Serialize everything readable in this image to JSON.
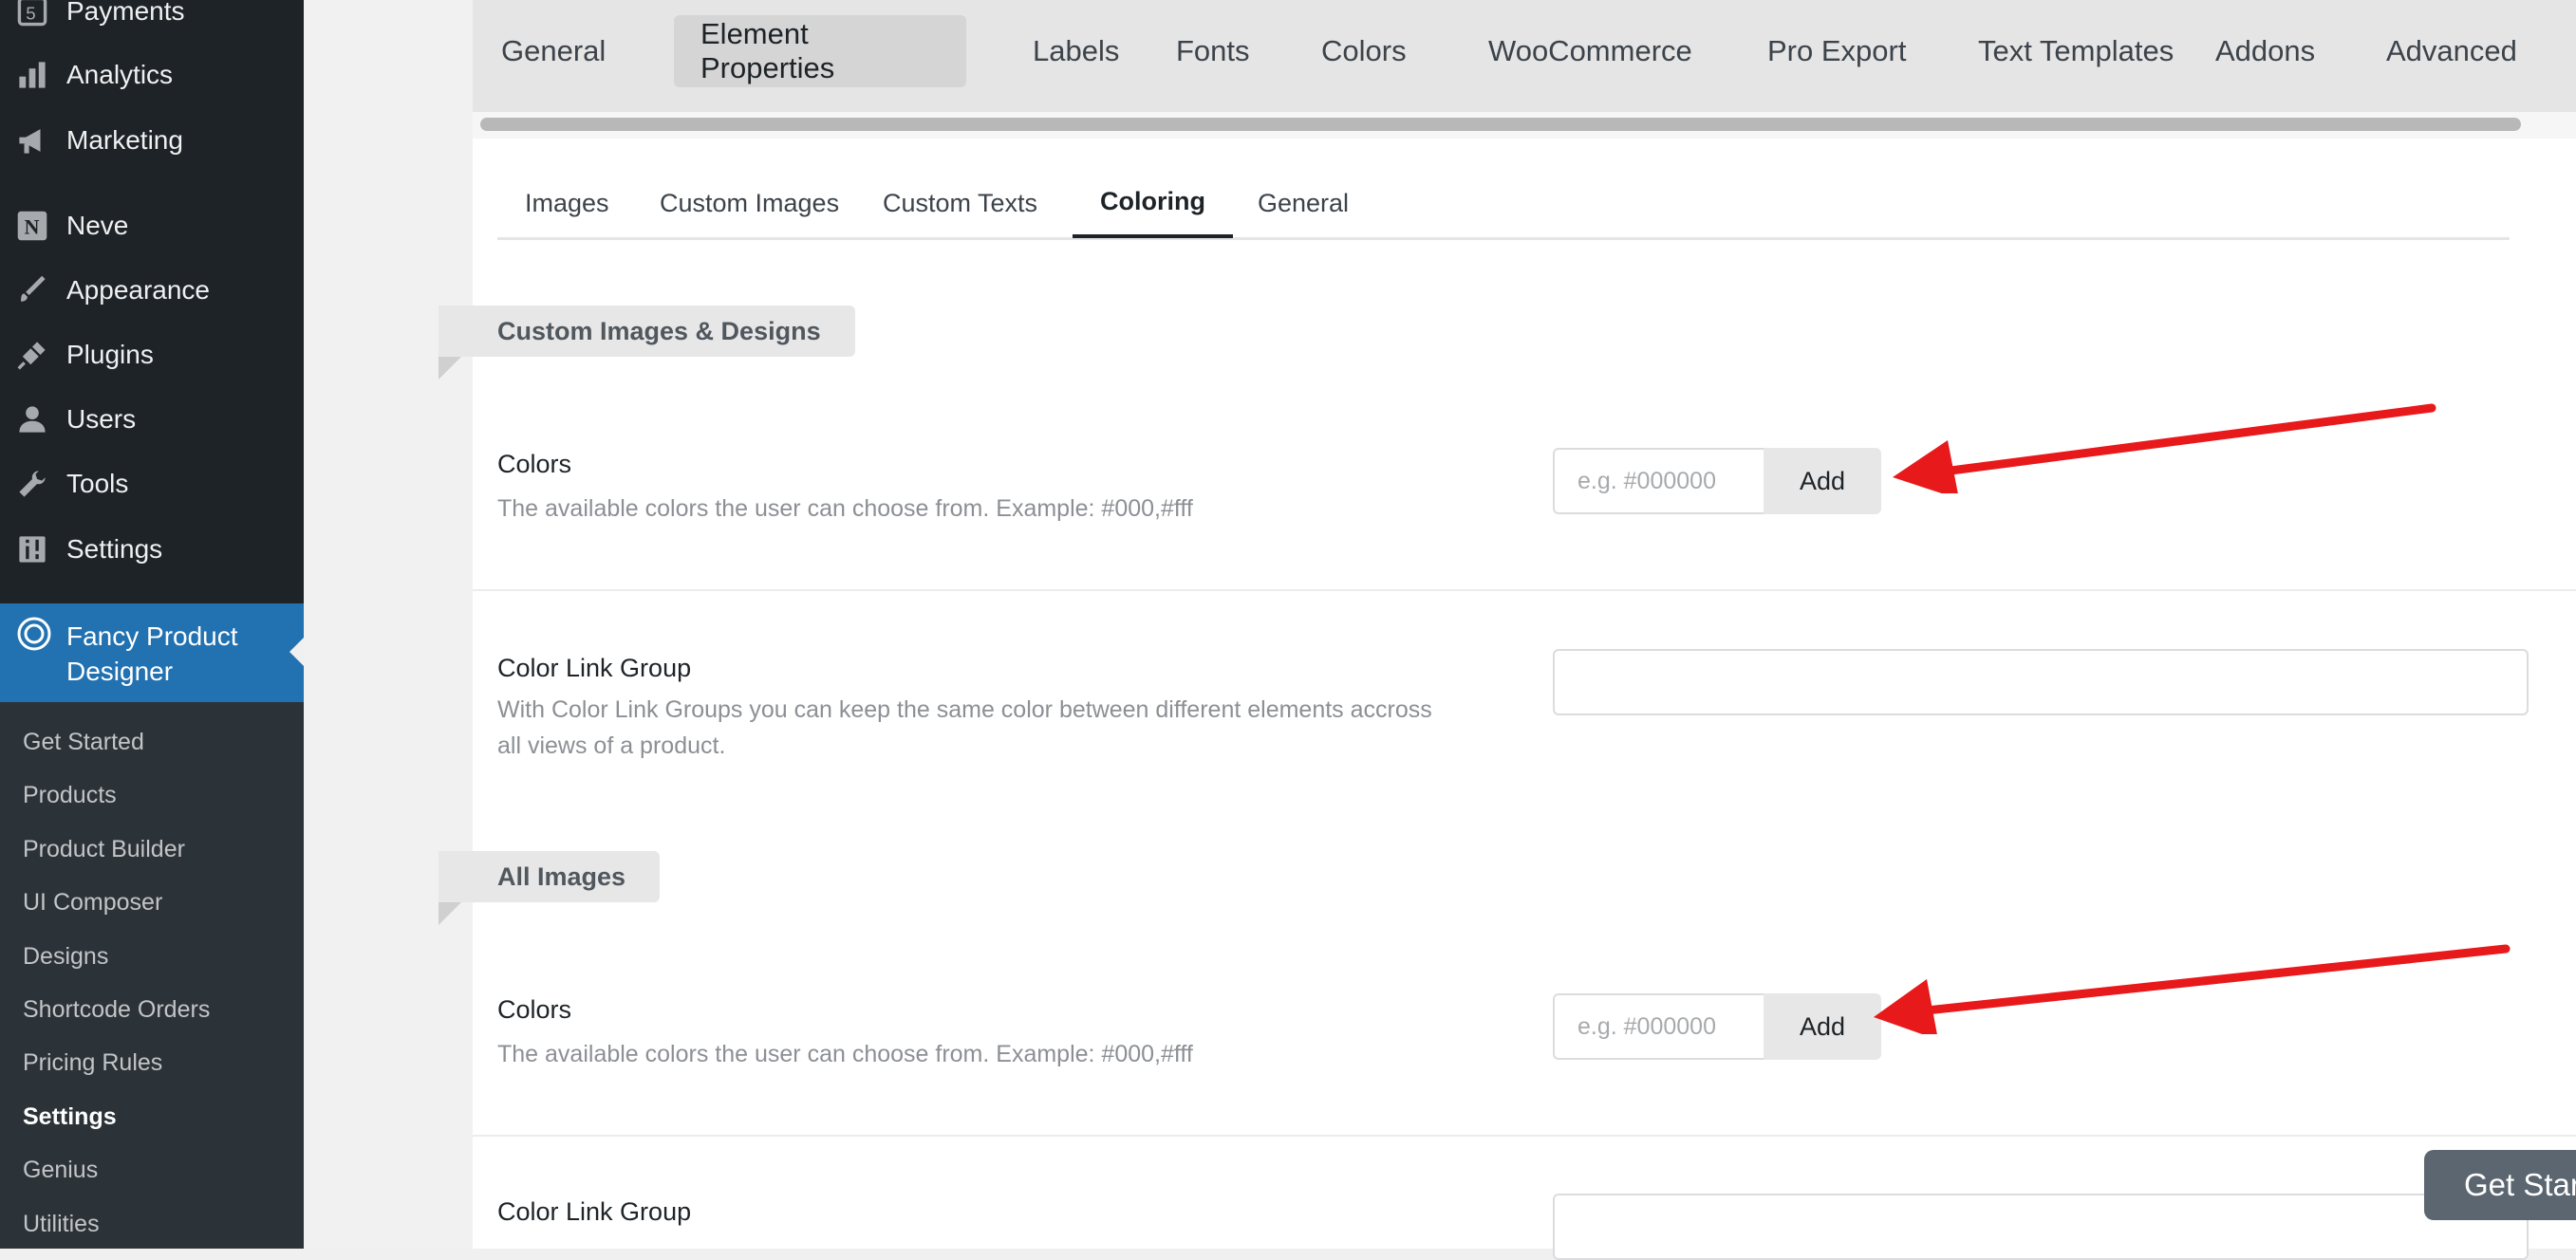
{
  "sidebar": {
    "items": [
      {
        "label": "Payments",
        "icon": "payments-icon"
      },
      {
        "label": "Analytics",
        "icon": "analytics-icon"
      },
      {
        "label": "Marketing",
        "icon": "megaphone-icon"
      },
      {
        "label": "Neve",
        "icon": "neve-icon"
      },
      {
        "label": "Appearance",
        "icon": "paintbrush-icon"
      },
      {
        "label": "Plugins",
        "icon": "plug-icon"
      },
      {
        "label": "Users",
        "icon": "user-icon"
      },
      {
        "label": "Tools",
        "icon": "wrench-icon"
      },
      {
        "label": "Settings",
        "icon": "sliders-icon"
      }
    ],
    "current": {
      "label": "Fancy Product Designer",
      "icon": "fpd-ring-icon"
    },
    "submenu": [
      "Get Started",
      "Products",
      "Product Builder",
      "UI Composer",
      "Designs",
      "Shortcode Orders",
      "Pricing Rules",
      "Settings",
      "Genius",
      "Utilities"
    ],
    "submenu_active": "Settings"
  },
  "top_tabs": [
    "General",
    "Element Properties",
    "Labels",
    "Fonts",
    "Colors",
    "WooCommerce",
    "Pro Export",
    "Text Templates",
    "Addons",
    "Advanced"
  ],
  "top_tab_active": "Element Properties",
  "sub_tabs": [
    "Images",
    "Custom Images",
    "Custom Texts",
    "Coloring",
    "General"
  ],
  "sub_tab_active": "Coloring",
  "sections": [
    {
      "title": "Custom Images & Designs",
      "colors": {
        "label": "Colors",
        "desc": "The available colors the user can choose from. Example: #000,#fff",
        "placeholder": "e.g. #000000",
        "button": "Add"
      },
      "link_group": {
        "label": "Color Link Group",
        "desc": "With Color Link Groups you can keep the same color between different elements accross all views of a product."
      }
    },
    {
      "title": "All Images",
      "colors": {
        "label": "Colors",
        "desc": "The available colors the user can choose from. Example: #000,#fff",
        "placeholder": "e.g. #000000",
        "button": "Add"
      },
      "link_group": {
        "label": "Color Link Group"
      }
    }
  ],
  "floating_button": "Get Star",
  "colors": {
    "sidebar_bg": "#1d2327",
    "submenu_bg": "#2c3338",
    "accent": "#2271b1",
    "annotation_arrow": "#e8191a"
  }
}
